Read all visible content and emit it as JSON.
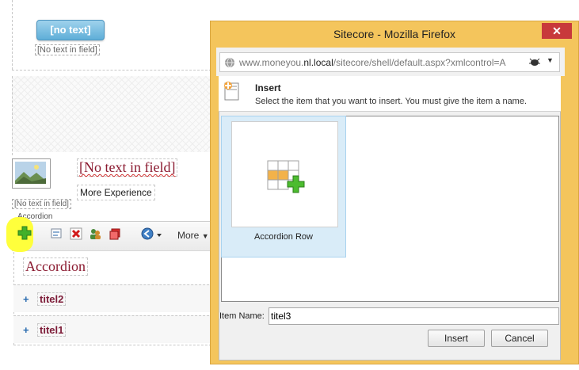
{
  "background": {
    "button_label": "[no text]",
    "placeholder_top": "[No text in field]",
    "heading_placeholder": "[No text in field]",
    "image_placeholder": "[No text in field]",
    "link_text": "More Experience",
    "component_label": "Accordion",
    "toolbar_more": "More",
    "accordion_title": "Accordion",
    "rows": [
      {
        "plus": "+",
        "title": "titel2"
      },
      {
        "plus": "+",
        "title": "titel1"
      }
    ],
    "highlight_color": "#ffff3c"
  },
  "window": {
    "title": "Sitecore - Mozilla Firefox",
    "close_glyph": "✕",
    "url_prefix": "www.moneyou.",
    "url_domain": "nl.local",
    "url_rest": "/sitecore/shell/default.aspx?xmlcontrol=A",
    "titlebar_color": "#f4c55c"
  },
  "dialog": {
    "heading": "Insert",
    "description": "Select the item that you want to insert. You must give the item a name.",
    "items": [
      {
        "label": "Accordion Row",
        "icon": "accordion-row-icon"
      }
    ],
    "item_name_label": "Item Name:",
    "item_name_value": "titel3",
    "insert_label": "Insert",
    "cancel_label": "Cancel"
  }
}
